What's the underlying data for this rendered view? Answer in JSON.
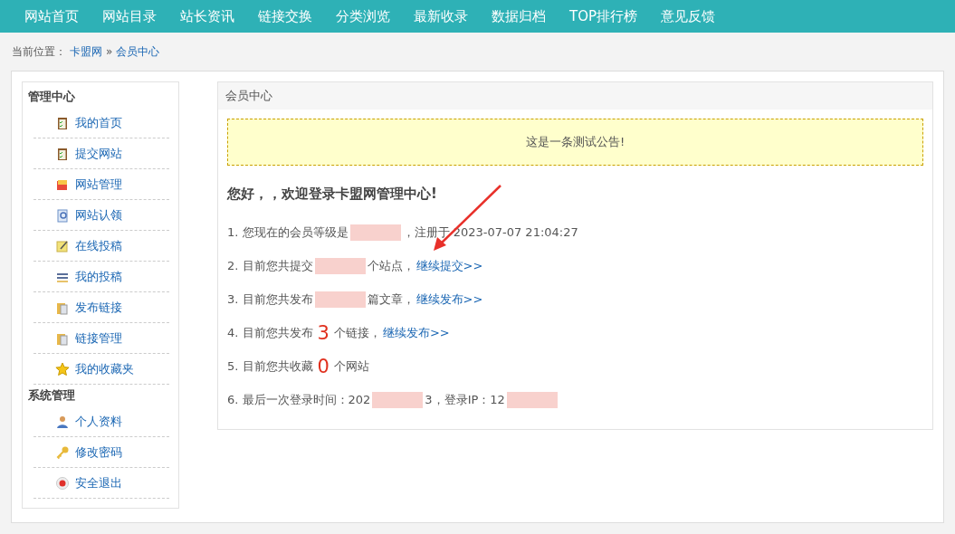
{
  "nav": [
    "网站首页",
    "网站目录",
    "站长资讯",
    "链接交换",
    "分类浏览",
    "最新收录",
    "数据归档",
    "TOP排行榜",
    "意见反馈"
  ],
  "breadcrumb": {
    "label": "当前位置：",
    "links": [
      "卡盟网",
      "会员中心"
    ],
    "separator": "»"
  },
  "sidebar": [
    {
      "title": "管理中心",
      "items": [
        {
          "label": "我的首页",
          "kind": "clipboard"
        },
        {
          "label": "提交网站",
          "kind": "clipboard"
        },
        {
          "label": "网站管理",
          "kind": "manage"
        },
        {
          "label": "网站认领",
          "kind": "search"
        },
        {
          "label": "在线投稿",
          "kind": "pencil"
        },
        {
          "label": "我的投稿",
          "kind": "list"
        },
        {
          "label": "发布链接",
          "kind": "folder"
        },
        {
          "label": "链接管理",
          "kind": "folder"
        },
        {
          "label": "我的收藏夹",
          "kind": "star"
        }
      ]
    },
    {
      "title": "系统管理",
      "items": [
        {
          "label": "个人资料",
          "kind": "user"
        },
        {
          "label": "修改密码",
          "kind": "key"
        },
        {
          "label": "安全退出",
          "kind": "exit"
        }
      ]
    }
  ],
  "panel": {
    "title": "会员中心",
    "notice": "这是一条测试公告!",
    "greeting": "您好，，欢迎登录卡盟网管理中心!",
    "lines": [
      [
        {
          "kind": "text",
          "text": "1. 您现在的会员等级是"
        },
        {
          "kind": "redacted"
        },
        {
          "kind": "text",
          "text": "，注册于 2023-07-07 21:04:27"
        }
      ],
      [
        {
          "kind": "text",
          "text": "2. 目前您共提交"
        },
        {
          "kind": "redacted"
        },
        {
          "kind": "text",
          "text": "个站点，"
        },
        {
          "kind": "link",
          "text": "继续提交>>"
        }
      ],
      [
        {
          "kind": "text",
          "text": "3. 目前您共发布"
        },
        {
          "kind": "redacted"
        },
        {
          "kind": "text",
          "text": "篇文章，"
        },
        {
          "kind": "link",
          "text": "继续发布>>"
        }
      ],
      [
        {
          "kind": "text",
          "text": "4. 目前您共发布"
        },
        {
          "kind": "number",
          "text": "3"
        },
        {
          "kind": "text",
          "text": "个链接，"
        },
        {
          "kind": "link",
          "text": "继续发布>>"
        }
      ],
      [
        {
          "kind": "text",
          "text": "5. 目前您共收藏"
        },
        {
          "kind": "number",
          "text": "0"
        },
        {
          "kind": "text",
          "text": "个网站"
        }
      ],
      [
        {
          "kind": "text",
          "text": "6. 最后一次登录时间：202"
        },
        {
          "kind": "redacted"
        },
        {
          "kind": "text",
          "text": "3，登录IP：12"
        },
        {
          "kind": "redacted"
        }
      ]
    ]
  }
}
